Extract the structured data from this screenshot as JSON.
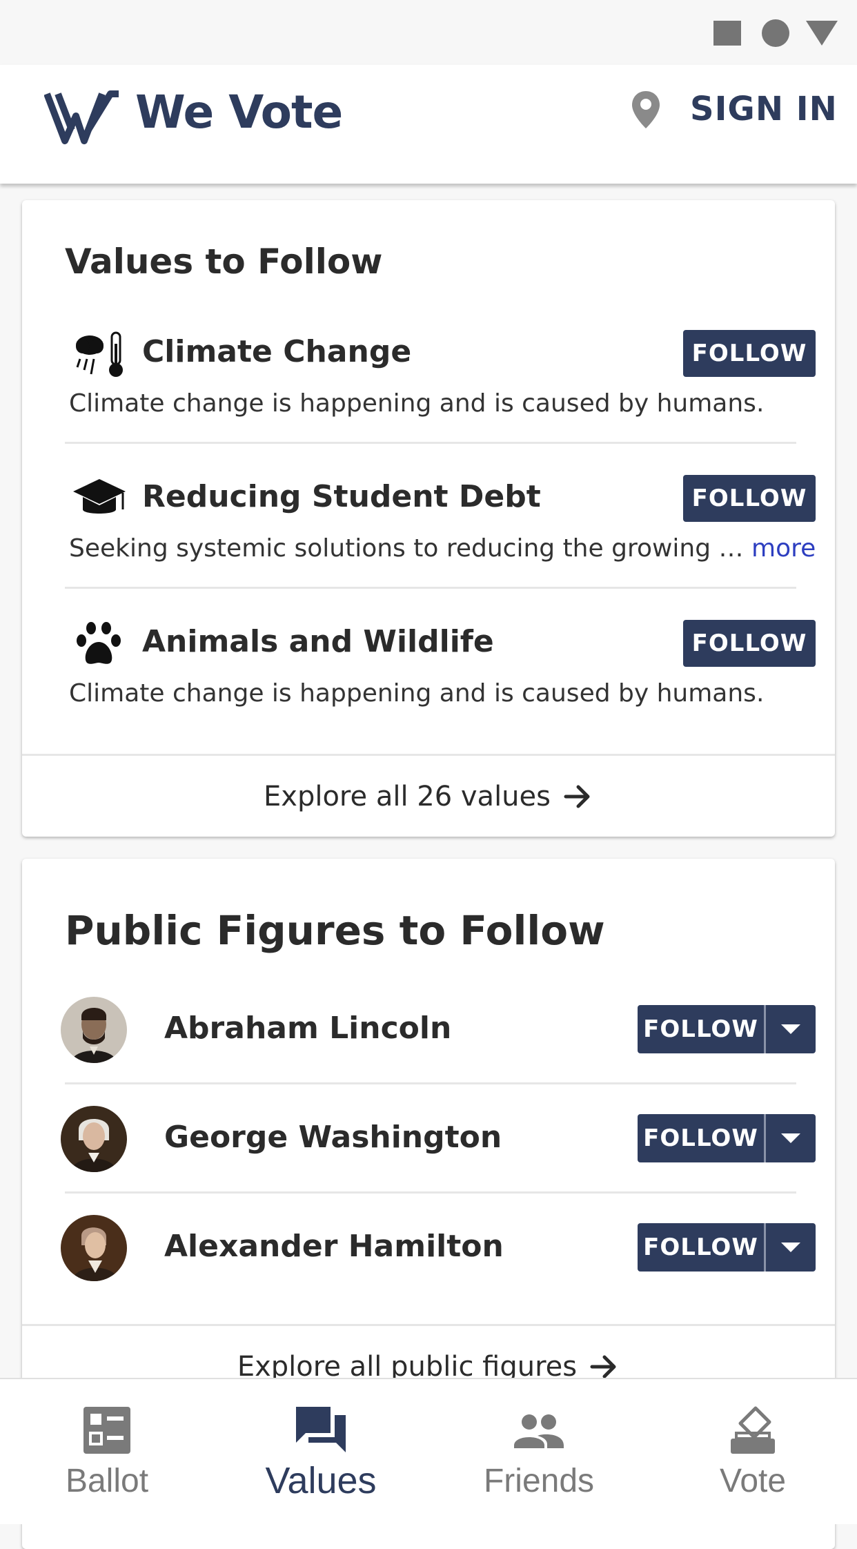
{
  "header": {
    "brand": "We Vote",
    "sign_in_label": "SIGN IN"
  },
  "values_card": {
    "title": "Values to Follow",
    "items": [
      {
        "icon": "climate-icon",
        "name": "Climate Change",
        "description": "Climate change is happening and is caused by humans.",
        "more": "",
        "button": "FOLLOW"
      },
      {
        "icon": "graduation-cap-icon",
        "name": "Reducing Student Debt",
        "description": "Seeking systemic solutions to reducing the growing …",
        "more": "more",
        "button": "FOLLOW"
      },
      {
        "icon": "paw-icon",
        "name": "Animals and Wildlife",
        "description": "Climate change is happening and is caused by humans.",
        "more": "",
        "button": "FOLLOW"
      }
    ],
    "explore_label": "Explore all 26 values"
  },
  "figures_card": {
    "title": "Public Figures to Follow",
    "items": [
      {
        "name": "Abraham Lincoln",
        "button": "FOLLOW"
      },
      {
        "name": "George Washington",
        "button": "FOLLOW"
      },
      {
        "name": "Alexander Hamilton",
        "button": "FOLLOW"
      }
    ],
    "explore_label": "Explore all public figures"
  },
  "bottom_nav": {
    "items": [
      {
        "label": "Ballot",
        "icon": "ballot-icon",
        "active": false
      },
      {
        "label": "Values",
        "icon": "values-icon",
        "active": true
      },
      {
        "label": "Friends",
        "icon": "friends-icon",
        "active": false
      },
      {
        "label": "Vote",
        "icon": "vote-icon",
        "active": false
      }
    ]
  },
  "colors": {
    "brand_navy": "#2e3c5d",
    "link_blue": "#2d3ec0",
    "inactive_gray": "#7a7a7a"
  }
}
